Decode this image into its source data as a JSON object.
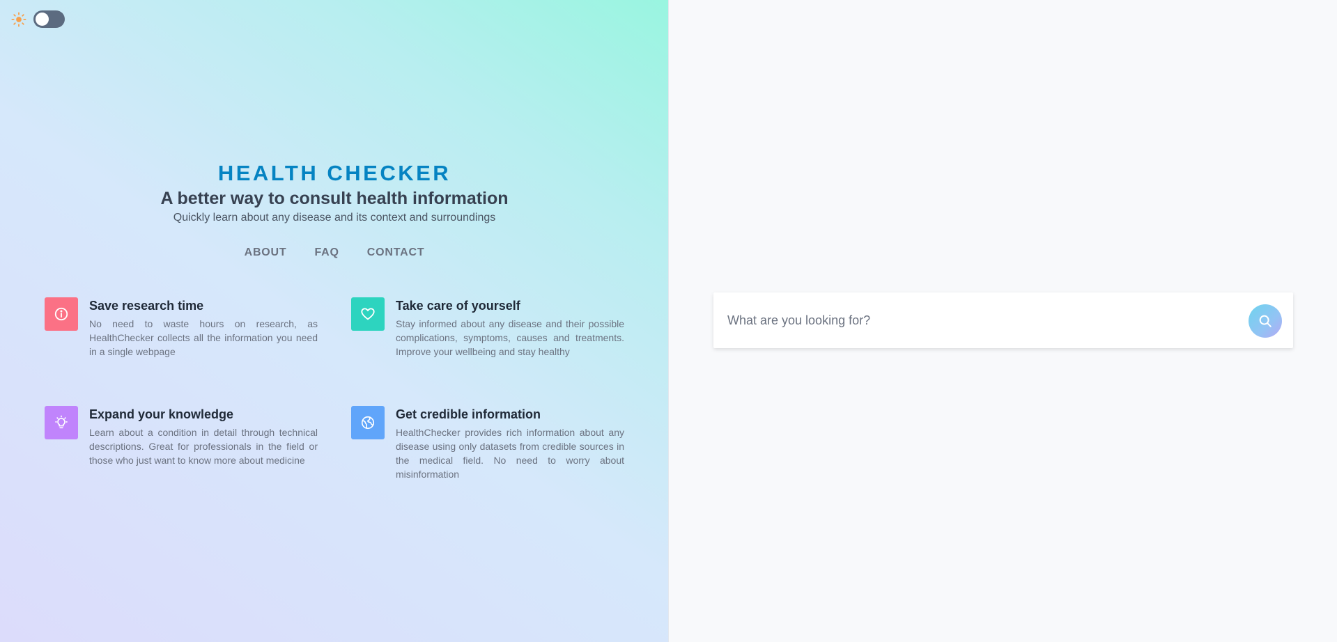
{
  "theme_toggle": {
    "icon": "sun-icon",
    "state": "off",
    "sun_color": "#f6a04d"
  },
  "hero": {
    "brand": "HEALTH CHECKER",
    "tagline": "A better way to consult health information",
    "subtitle": "Quickly learn about any disease and its context and surroundings"
  },
  "nav": {
    "items": [
      {
        "label": "ABOUT"
      },
      {
        "label": "FAQ"
      },
      {
        "label": "CONTACT"
      }
    ]
  },
  "features": [
    {
      "icon": "info-icon",
      "color": "#fb7185",
      "title": "Save research time",
      "description": "No need to waste hours on research, as HealthChecker collects all the information you need in a single webpage"
    },
    {
      "icon": "heart-icon",
      "color": "#2dd4bf",
      "title": "Take care of yourself",
      "description": "Stay informed about any disease and their possible complications, symptoms, causes and treatments. Improve your wellbeing and stay healthy"
    },
    {
      "icon": "lightbulb-icon",
      "color": "#c084fc",
      "title": "Expand your knowledge",
      "description": "Learn about a condition in detail through technical descriptions. Great for professionals in the field or those who just want to know more about medicine"
    },
    {
      "icon": "globe-icon",
      "color": "#60a5fa",
      "title": "Get credible information",
      "description": "HealthChecker provides rich information about any disease using only datasets from credible sources in the medical field. No need to worry about misinformation"
    }
  ],
  "search": {
    "placeholder": "What are you looking for?",
    "value": "",
    "button_icon": "search-icon"
  }
}
